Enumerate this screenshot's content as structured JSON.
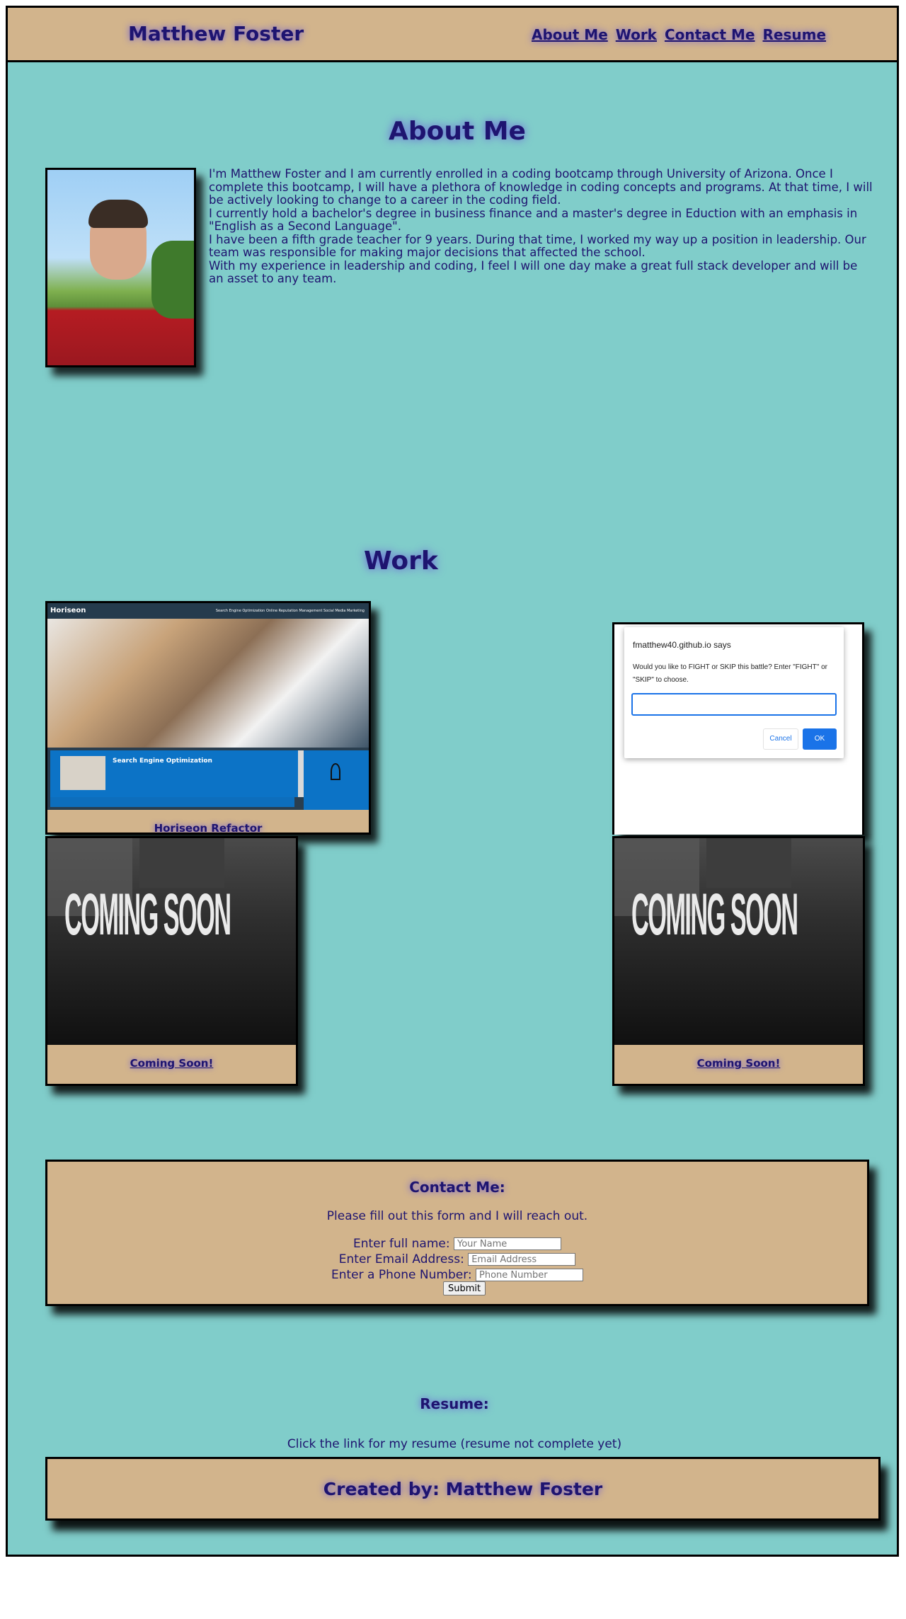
{
  "header": {
    "name": "Matthew Foster",
    "nav": [
      "About Me",
      "Work",
      "Contact Me",
      "Resume"
    ]
  },
  "about": {
    "title": "About Me",
    "paragraphs": [
      "I'm Matthew Foster and I am currently enrolled in a coding bootcamp through University of Arizona. Once I complete this bootcamp, I will have a plethora of knowledge in coding concepts and programs. At that time, I will be actively looking to change to a career in the coding field.",
      "I currently hold a bachelor's degree in business finance and a master's degree in Eduction with an emphasis in \"English as a Second Language\".",
      "I have been a fifth grade teacher for 9 years. During that time, I worked my way up a position in leadership. Our team was responsible for making major decisions that affected the school.",
      "With my experience in leadership and coding, I feel I will one day make a great full stack developer and will be an asset to any team."
    ]
  },
  "work": {
    "title": "Work",
    "horiseon": {
      "caption": "Horiseon Refactor",
      "screenshot": {
        "brand": "Horiseon",
        "nav_links": "Search Engine Optimization   Online Reputation Management   Social Media Marketing",
        "section_heading": "Search Engine Optimization"
      }
    },
    "dialog": {
      "title": "fmatthew40.github.io says",
      "message": "Would you like to FIGHT or SKIP this battle? Enter \"FIGHT\" or \"SKIP\" to choose.",
      "cancel": "Cancel",
      "ok": "OK"
    },
    "coming_soon_image_text": "COMING SOON",
    "coming_soon_1": "Coming Soon!",
    "coming_soon_2": "Coming Soon!"
  },
  "contact": {
    "title": "Contact Me:",
    "intro": "Please fill out this form and I will reach out.",
    "name_label": "Enter full name:",
    "name_placeholder": "Your Name",
    "email_label": "Enter Email Address:",
    "email_placeholder": "Email Address",
    "phone_label": "Enter a Phone Number:",
    "phone_placeholder": "Phone Number",
    "submit": "Submit"
  },
  "resume": {
    "title": "Resume:",
    "text": "Click the link for my resume (resume not complete yet)"
  },
  "footer": {
    "credit": "Created by: Matthew Foster"
  },
  "colors": {
    "page_background": "#80cdca",
    "panel_tan": "#d2b48c",
    "text_navy": "#1e1470"
  }
}
